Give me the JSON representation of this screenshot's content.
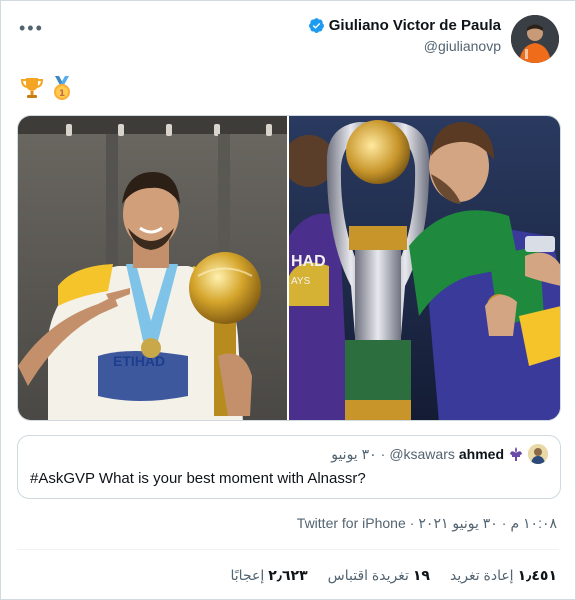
{
  "author": {
    "display_name": "Giuliano Victor de Paula",
    "handle": "@giulianovp"
  },
  "tweet": {
    "emojis": [
      "trophy",
      "first-place-medal"
    ]
  },
  "quoted": {
    "name": "ahmed",
    "handle": "@ksawars",
    "dot": "·",
    "date": "٣٠ يونيو",
    "text": "#AskGVP What is your best moment with Alnassr?"
  },
  "meta": {
    "time": "١٠:٠٨ م",
    "dot": "·",
    "date": "٣٠ يونيو ٢٠٢١",
    "dot2": "·",
    "source": "Twitter for iPhone"
  },
  "stats": {
    "retweets_count": "١٫٤٥١",
    "retweets_label": "إعادة تغريد",
    "quotes_count": "١٩",
    "quotes_label": "تغريدة اقتباس",
    "likes_count": "٢٫٦٢٣",
    "likes_label": "إعجابًا"
  },
  "colors": {
    "verified_blue": "#1d9bf0",
    "text_primary": "#0f1419",
    "text_secondary": "#536471",
    "border": "#cfd9de"
  }
}
